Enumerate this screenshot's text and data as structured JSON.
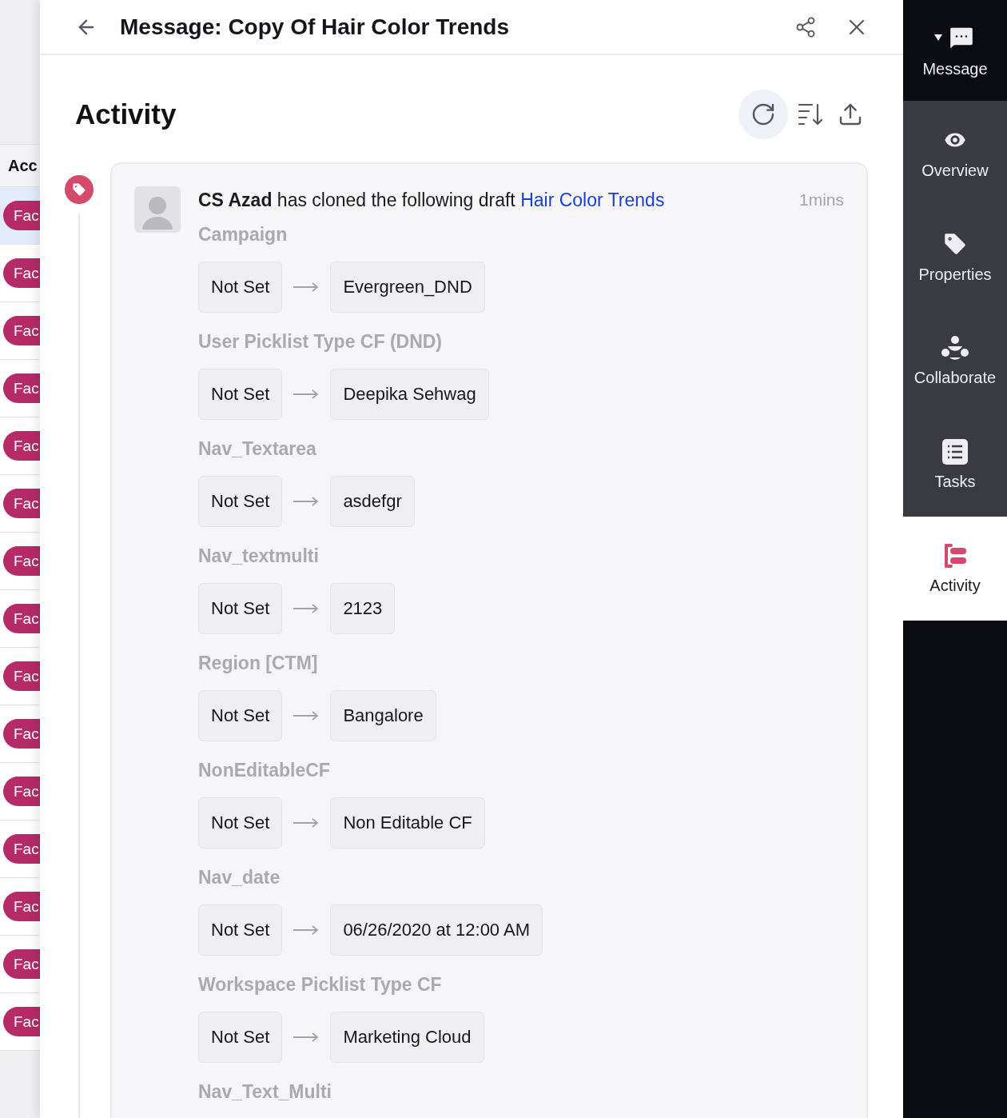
{
  "background_list": {
    "column_header": "Acc",
    "rows": [
      {
        "tag": "Fac",
        "selected": true
      },
      {
        "tag": "Fac",
        "selected": false
      },
      {
        "tag": "Fac",
        "selected": false
      },
      {
        "tag": "Fac",
        "selected": false
      },
      {
        "tag": "Fac",
        "selected": false
      },
      {
        "tag": "Fac",
        "selected": false
      },
      {
        "tag": "Fac",
        "selected": false
      },
      {
        "tag": "Fac",
        "selected": false
      },
      {
        "tag": "Fac",
        "selected": false
      },
      {
        "tag": "Fac",
        "selected": false
      },
      {
        "tag": "Fac",
        "selected": false
      },
      {
        "tag": "Fac",
        "selected": false
      },
      {
        "tag": "Fac",
        "selected": false
      },
      {
        "tag": "Fac",
        "selected": false
      },
      {
        "tag": "Fac",
        "selected": false
      }
    ]
  },
  "window": {
    "title": "Message: Copy Of Hair Color Trends"
  },
  "section_title": "Activity",
  "activity": {
    "actor": "CS Azad",
    "action": "has cloned the following draft",
    "link": "Hair Color Trends",
    "time": "1mins",
    "changes": [
      {
        "field": "Campaign",
        "from": "Not Set",
        "to": "Evergreen_DND"
      },
      {
        "field": "User Picklist Type CF (DND)",
        "from": "Not Set",
        "to": "Deepika Sehwag"
      },
      {
        "field": "Nav_Textarea",
        "from": "Not Set",
        "to": "asdefgr"
      },
      {
        "field": "Nav_textmulti",
        "from": "Not Set",
        "to": "2123"
      },
      {
        "field": "Region [CTM]",
        "from": "Not Set",
        "to": "Bangalore"
      },
      {
        "field": "NonEditableCF",
        "from": "Not Set",
        "to": "Non Editable CF"
      },
      {
        "field": "Nav_date",
        "from": "Not Set",
        "to": "06/26/2020 at 12:00 AM"
      },
      {
        "field": "Workspace Picklist Type CF",
        "from": "Not Set",
        "to": "Marketing Cloud"
      },
      {
        "field": "Nav_Text_Multi"
      }
    ]
  },
  "sidebar": {
    "items": [
      {
        "kind": "message",
        "label": "Message",
        "selected": false
      },
      {
        "kind": "overview",
        "label": "Overview",
        "selected": false
      },
      {
        "kind": "properties",
        "label": "Properties",
        "selected": false
      },
      {
        "kind": "collaborate",
        "label": "Collaborate",
        "selected": false
      },
      {
        "kind": "tasks",
        "label": "Tasks",
        "selected": false
      },
      {
        "kind": "activity",
        "label": "Activity",
        "selected": true
      }
    ]
  }
}
